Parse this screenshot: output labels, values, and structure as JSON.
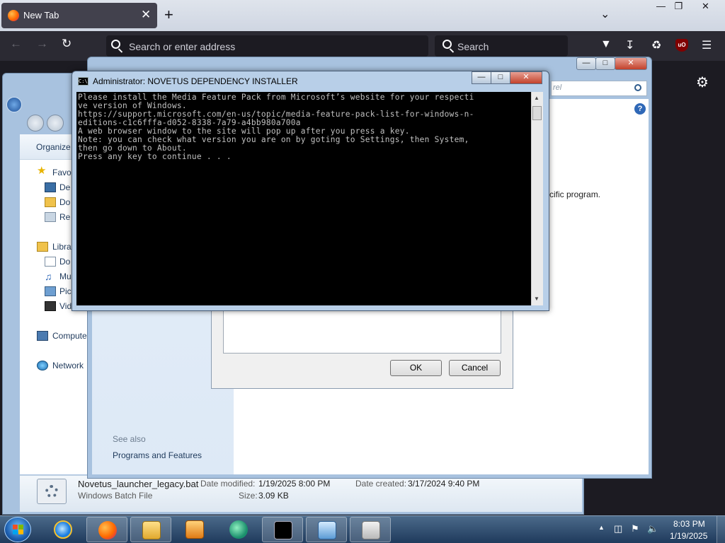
{
  "firefox": {
    "tab_title": "New Tab",
    "tab_close": "✕",
    "new_tab": "+",
    "chevron": "⌄",
    "address_placeholder": "Search or enter address",
    "search_placeholder": "Search",
    "ublock_label": "uO",
    "window_controls": {
      "minimize": "—",
      "restore": "❐",
      "close": "✕"
    }
  },
  "explorer": {
    "organize": "Organize",
    "nav_items": [
      {
        "label": "Favo"
      },
      {
        "label": "De"
      },
      {
        "label": "Do"
      },
      {
        "label": "Re"
      },
      {
        "label": "Libra"
      },
      {
        "label": "Do"
      },
      {
        "label": "Mu"
      },
      {
        "label": "Pic"
      },
      {
        "label": "Vid"
      },
      {
        "label": "Compute"
      },
      {
        "label": "Network"
      }
    ],
    "details": {
      "file_name": "Novetus_launcher_legacy.bat",
      "file_type": "Windows Batch File",
      "date_modified_label": "Date modified:",
      "date_modified": "1/19/2025 8:00 PM",
      "date_created_label": "Date created:",
      "date_created": "3/17/2024 9:40 PM",
      "size_label": "Size:",
      "size": "3.09 KB"
    }
  },
  "control_panel": {
    "search_placeholder": "rel",
    "body_text": "cific program.",
    "see_also": "See also",
    "programs_and_features": "Programs and Features",
    "help": "?"
  },
  "dialog": {
    "ok": "OK",
    "cancel": "Cancel"
  },
  "cmd": {
    "title": "Administrator:  NOVETUS DEPENDENCY INSTALLER",
    "lines": [
      "Please install the Media Feature Pack from Microsoft’s website for your respecti",
      "ve version of Windows.",
      "https://support.microsoft.com/en-us/topic/media-feature-pack-list-for-windows-n-",
      "editions-c1c6fffa-d052-8338-7a79-a4bb980a700a",
      "A web browser window to the site will pop up after you press a key.",
      "Note: you can check what version you are on by goting to Settings, then System,",
      "then go down to About.",
      "Press any key to continue . . ."
    ]
  },
  "taskbar": {
    "time": "8:03 PM",
    "date": "1/19/2025"
  }
}
